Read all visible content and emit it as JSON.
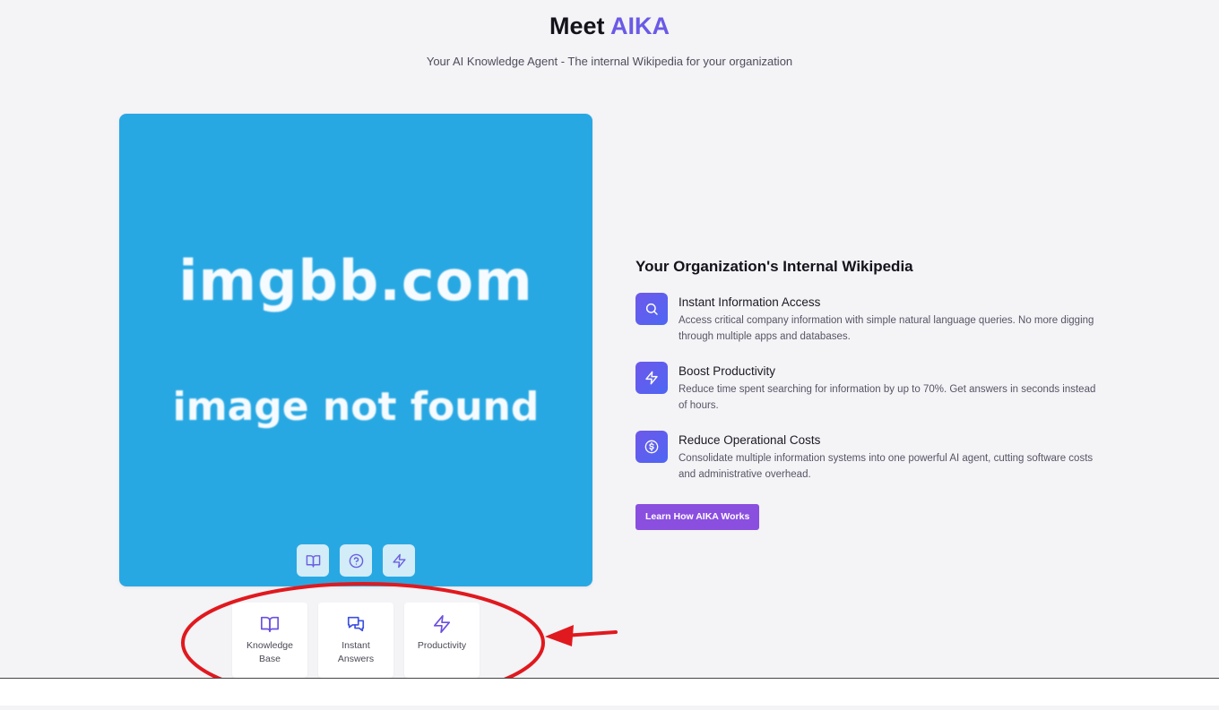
{
  "header": {
    "title_prefix": "Meet",
    "title_accent": "AIKA",
    "subtitle": "Your AI Knowledge Agent - The internal Wikipedia for your organization"
  },
  "hero": {
    "placeholder_line1": "imgbb.com",
    "placeholder_line2": "image not found",
    "buttons": [
      {
        "icon": "book-icon"
      },
      {
        "icon": "help-circle-icon"
      },
      {
        "icon": "lightning-icon"
      }
    ]
  },
  "cards": [
    {
      "icon": "book-icon",
      "label": "Knowledge Base"
    },
    {
      "icon": "chat-icon",
      "label": "Instant Answers"
    },
    {
      "icon": "lightning-icon",
      "label": "Productivity"
    }
  ],
  "section": {
    "title": "Your Organization's Internal Wikipedia",
    "features": [
      {
        "icon": "search-icon",
        "title": "Instant Information Access",
        "description": "Access critical company information with simple natural language queries. No more digging through multiple apps and databases."
      },
      {
        "icon": "lightning-icon",
        "title": "Boost Productivity",
        "description": "Reduce time spent searching for information by up to 70%. Get answers in seconds instead of hours."
      },
      {
        "icon": "dollar-icon",
        "title": "Reduce Operational Costs",
        "description": "Consolidate multiple information systems into one powerful AI agent, cutting software costs and administrative overhead."
      }
    ],
    "cta_label": "Learn How AIKA Works"
  },
  "colors": {
    "accent": "#6a5ae6",
    "hero_bg": "#28a8e3",
    "cta_bg": "#8a4fdf",
    "annotation": "#e0191e"
  }
}
